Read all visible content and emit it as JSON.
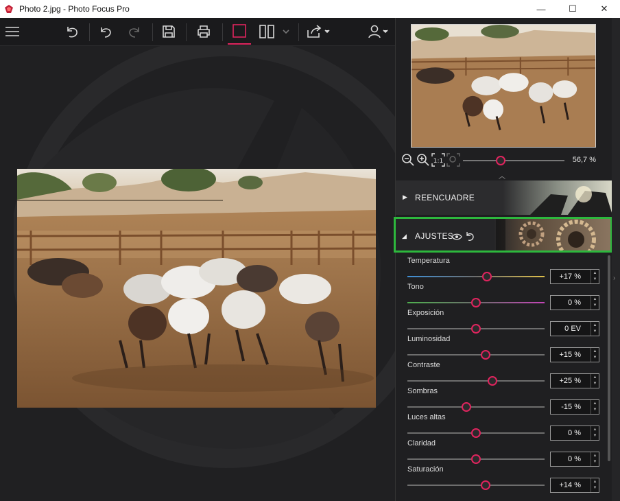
{
  "window": {
    "title": "Photo 2.jpg - Photo Focus Pro",
    "minimize": "—",
    "maximize": "☐",
    "close": "✕"
  },
  "toolbar": {
    "icons": [
      "menu-icon",
      "undo-history-icon",
      "undo-icon",
      "redo-icon",
      "save-icon",
      "print-icon",
      "single-view-icon",
      "split-view-icon",
      "share-icon",
      "user-icon"
    ]
  },
  "navigator": {
    "zoom_value": "56,7 %",
    "zoom_level": 0.37
  },
  "sections": {
    "reencuadre": "REENCUADRE",
    "ajustes": "AJUSTES"
  },
  "adjustments": [
    {
      "name": "Temperatura",
      "value": "+17 %",
      "level": 0.58
    },
    {
      "name": "Tono",
      "value": "0 %",
      "level": 0.5
    },
    {
      "name": "Exposición",
      "value": "0 EV",
      "level": 0.5
    },
    {
      "name": "Luminosidad",
      "value": "+15 %",
      "level": 0.57
    },
    {
      "name": "Contraste",
      "value": "+25 %",
      "level": 0.62
    },
    {
      "name": "Sombras",
      "value": "-15 %",
      "level": 0.43
    },
    {
      "name": "Luces altas",
      "value": "0 %",
      "level": 0.5
    },
    {
      "name": "Claridad",
      "value": "0 %",
      "level": 0.5
    },
    {
      "name": "Saturación",
      "value": "+14 %",
      "level": 0.57
    }
  ],
  "colors": {
    "accent": "#e0245e",
    "highlight_border": "#2db83d",
    "temperature_left": "#3f8fd6",
    "temperature_right": "#e0c04a",
    "tint_left": "#4fb04f",
    "tint_right": "#c545b8"
  }
}
